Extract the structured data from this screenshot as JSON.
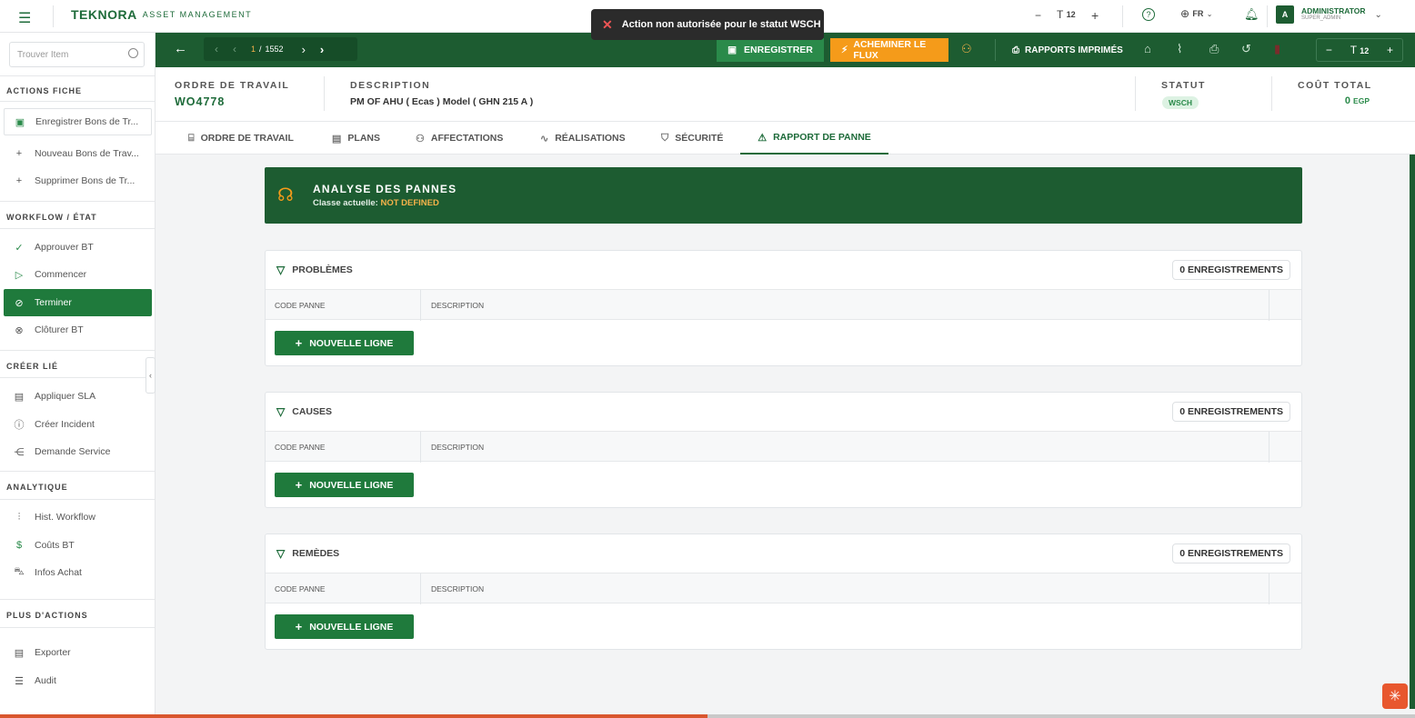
{
  "topbar": {
    "logo_brand": "TEKNORA",
    "logo_sub": "ASSET MANAGEMENT",
    "font_size": "12",
    "lang": "FR",
    "user_initial": "A",
    "user_name": "ADMINISTRATOR",
    "user_role": "SUPER_ADMIN"
  },
  "toast": {
    "message": "Action non autorisée pour le statut WSCH"
  },
  "sidebar": {
    "search_placeholder": "Trouver Item",
    "sections": {
      "actions": "ACTIONS FICHE",
      "workflow": "WORKFLOW / ÉTAT",
      "create": "CRÉER LIÉ",
      "analytics": "ANALYTIQUE",
      "more": "PLUS D'ACTIONS"
    },
    "items": {
      "save": "Enregistrer Bons de Tr...",
      "new": "Nouveau Bons de Trav...",
      "delete": "Supprimer Bons de Tr...",
      "approve": "Approuver BT",
      "start": "Commencer",
      "finish": "Terminer",
      "close": "Clôturer BT",
      "sla": "Appliquer SLA",
      "incident": "Créer Incident",
      "service": "Demande Service",
      "hist": "Hist. Workflow",
      "costs": "Coûts BT",
      "purchase": "Infos Achat",
      "export": "Exporter",
      "audit": "Audit"
    }
  },
  "toolbar": {
    "page_current": "1",
    "page_total": "1552",
    "save_label": "ENREGISTRER",
    "route_label": "ACHEMINER LE FLUX",
    "reports_label": "RAPPORTS IMPRIMÉS",
    "font_size": "12"
  },
  "header": {
    "wo_label": "ORDRE DE TRAVAIL",
    "wo_value": "WO4778",
    "desc_label": "DESCRIPTION",
    "desc_value": "PM OF AHU ( Ecas ) Model ( GHN 215 A )",
    "status_label": "STATUT",
    "status_value": "WSCH",
    "cost_label": "COÛT TOTAL",
    "cost_value": "0",
    "cost_currency": "EGP"
  },
  "tabs": {
    "t1": "ORDRE DE TRAVAIL",
    "t2": "PLANS",
    "t3": "AFFECTATIONS",
    "t4": "RÉALISATIONS",
    "t5": "SÉCURITÉ",
    "t6": "RAPPORT DE PANNE"
  },
  "banner": {
    "title": "ANALYSE DES PANNES",
    "class_label": "Classe actuelle:",
    "class_value": "NOT DEFINED"
  },
  "panels": {
    "problems": {
      "title": "PROBLÈMES",
      "count": "0 ENREGISTREMENTS"
    },
    "causes": {
      "title": "CAUSES",
      "count": "0 ENREGISTREMENTS"
    },
    "remedies": {
      "title": "REMÈDES",
      "count": "0 ENREGISTREMENTS"
    },
    "col_code": "CODE PANNE",
    "col_desc": "DESCRIPTION",
    "add_label": "NOUVELLE LIGNE"
  },
  "colors": {
    "brand_green": "#1d5c31",
    "accent_orange": "#f59b1a",
    "active_green": "#1f7a3c"
  }
}
